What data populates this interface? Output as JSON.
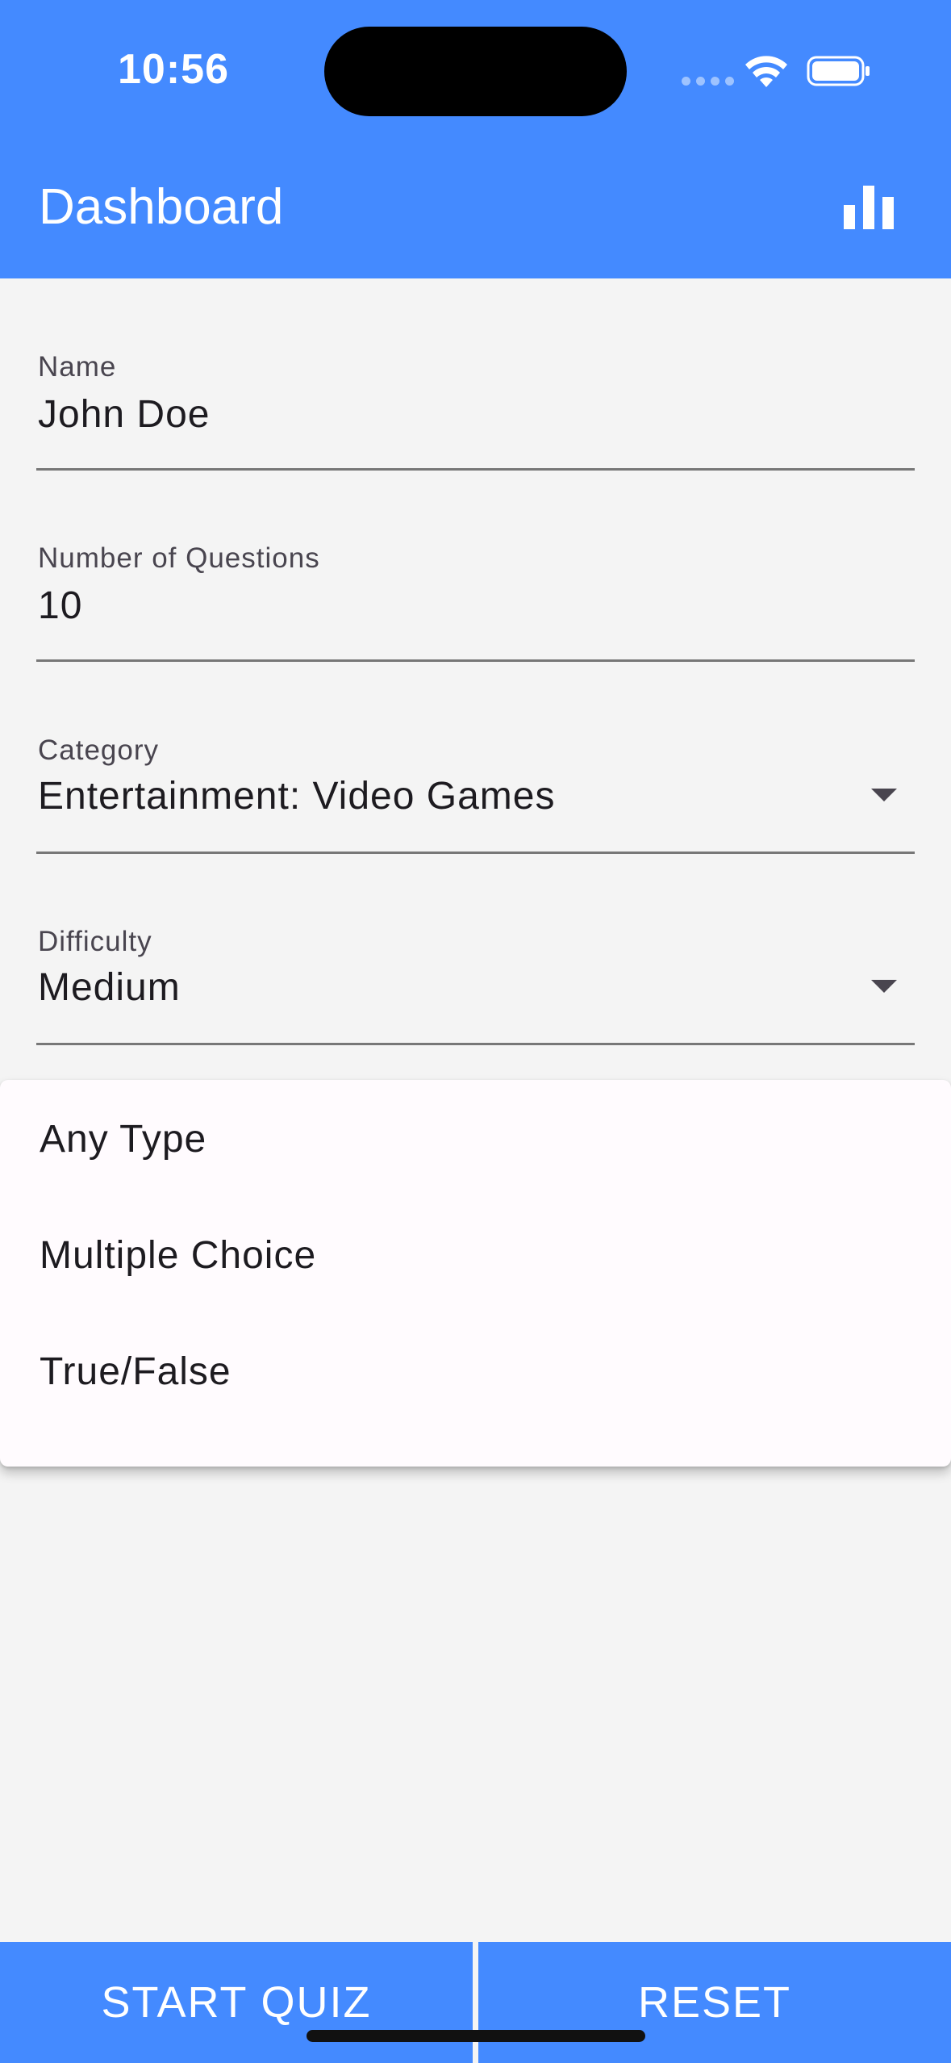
{
  "status_bar": {
    "time": "10:56"
  },
  "appbar": {
    "title": "Dashboard",
    "action_icon": "bar-chart-icon"
  },
  "form": {
    "name": {
      "label": "Name",
      "value": "John Doe"
    },
    "num_questions": {
      "label": "Number of Questions",
      "value": "10"
    },
    "category": {
      "label": "Category",
      "value": "Entertainment: Video Games"
    },
    "difficulty": {
      "label": "Difficulty",
      "value": "Medium"
    }
  },
  "type_menu": {
    "options": [
      "Any Type",
      "Multiple Choice",
      "True/False"
    ]
  },
  "buttons": {
    "start": "START QUIZ",
    "reset": "RESET"
  },
  "colors": {
    "primary": "#448aff",
    "background": "#f4f4f4",
    "menu_surface": "#fffbfe"
  }
}
